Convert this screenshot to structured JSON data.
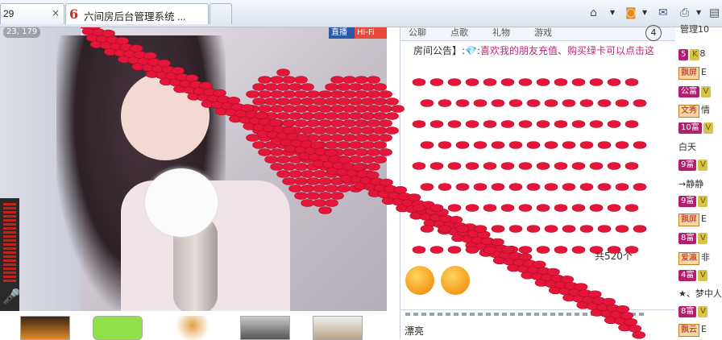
{
  "browser": {
    "tabs": [
      {
        "title": "29",
        "close": "×"
      },
      {
        "title": "六间房后台管理系统 ...",
        "logo": "6"
      },
      {
        "title": ""
      }
    ]
  },
  "video": {
    "viewer_count": "23, 179",
    "badge_live": "直播",
    "badge_hifi": "Hi-Fi"
  },
  "chat": {
    "tabs": [
      "公聊",
      "点歌",
      "礼物",
      "游戏"
    ],
    "tab_count": "4",
    "announce_label": "房间公告】:",
    "announce_text": "喜欢我的朋友充值、购买绿卡可以点击这",
    "gift_count": "共520个",
    "input_text": "漂亮"
  },
  "sidebar": {
    "title": "管理10",
    "rows": [
      {
        "level": "5",
        "vip": "K",
        "tag": "",
        "name": "8"
      },
      {
        "level": "",
        "vip": "",
        "tag": "飘屏",
        "name": "E"
      },
      {
        "level": "公富",
        "vip": "V",
        "tag": "",
        "name": ""
      },
      {
        "level": "",
        "vip": "",
        "tag": "文秀",
        "name": "情"
      },
      {
        "level": "10富",
        "vip": "V",
        "tag": "",
        "name": ""
      },
      {
        "level": "",
        "vip": "",
        "tag": "",
        "name": "白天"
      },
      {
        "level": "9富",
        "vip": "V",
        "tag": "",
        "name": ""
      },
      {
        "level": "",
        "vip": "",
        "tag": "",
        "name": "→静静"
      },
      {
        "level": "9富",
        "vip": "V",
        "tag": "",
        "name": ""
      },
      {
        "level": "",
        "vip": "",
        "tag": "飘屏",
        "name": "E"
      },
      {
        "level": "8富",
        "vip": "V",
        "tag": "",
        "name": ""
      },
      {
        "level": "",
        "vip": "",
        "tag": "爱瀛",
        "name": "非"
      },
      {
        "level": "4富",
        "vip": "V",
        "tag": "",
        "name": ""
      },
      {
        "level": "",
        "vip": "",
        "tag": "",
        "name": "★、梦中人"
      },
      {
        "level": "8富",
        "vip": "V",
        "tag": "",
        "name": ""
      },
      {
        "level": "",
        "vip": "",
        "tag": "飘云",
        "name": "E"
      }
    ]
  },
  "colors": {
    "heart": "#e5163a",
    "accent": "#c0267a"
  }
}
